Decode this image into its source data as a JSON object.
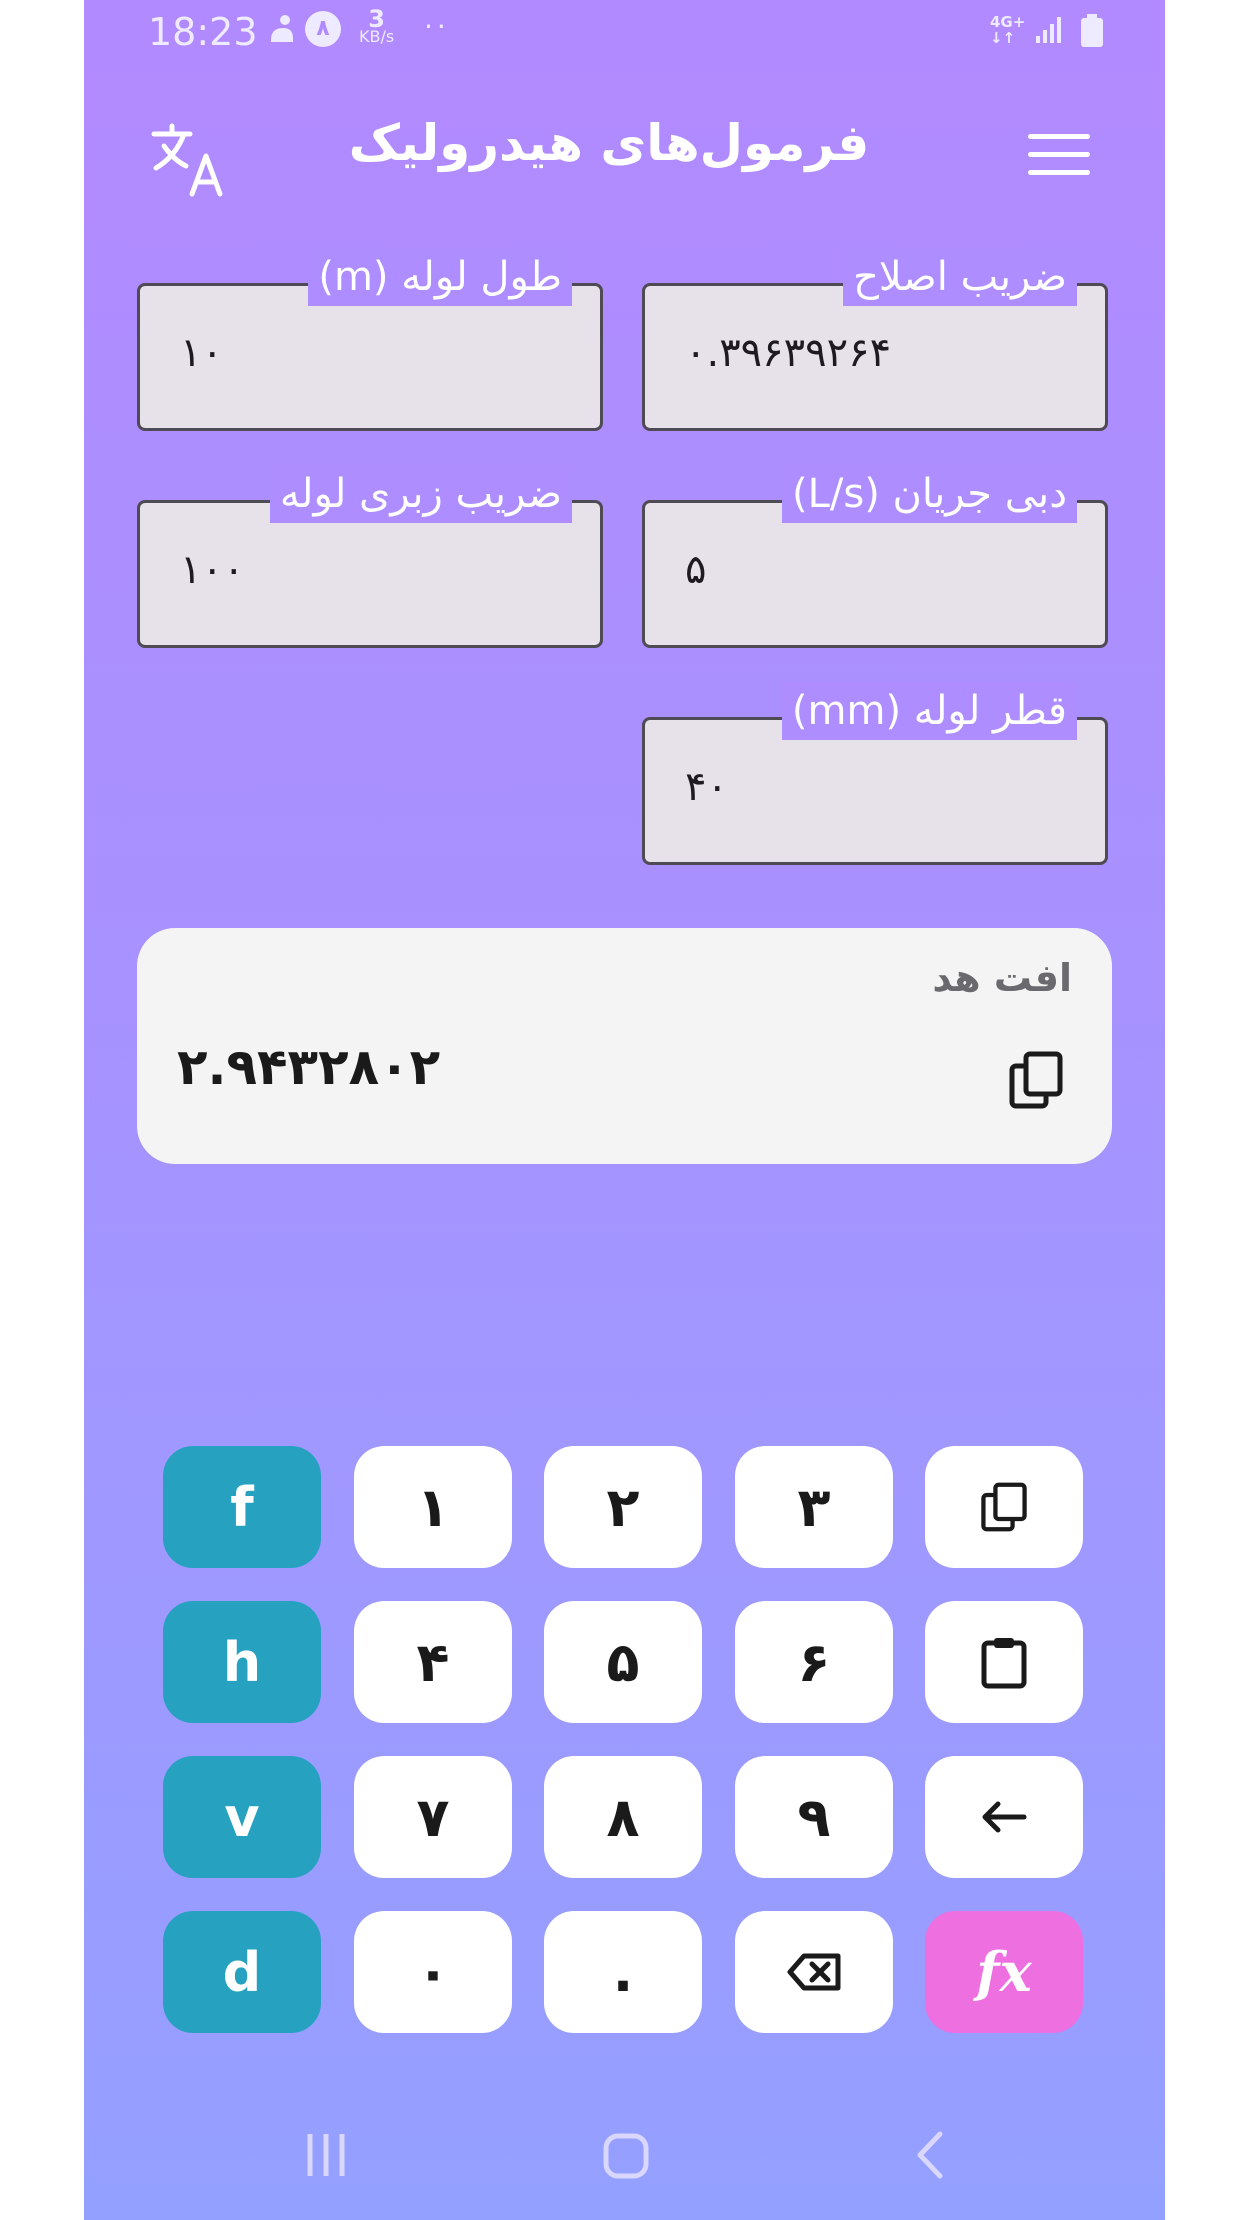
{
  "status_bar": {
    "time": "18:23",
    "badge": "۸",
    "net_speed": "3",
    "net_unit": "KB/s",
    "dots": "··",
    "network": "4G+"
  },
  "app_bar": {
    "title": "فرمول‌های هیدرولیک"
  },
  "fields": [
    {
      "label": "ضریب اصلاح",
      "value": "۰.۳۹۶۳۹۲۶۴"
    },
    {
      "label": "طول لوله (m)",
      "value": "۱۰"
    },
    {
      "label": "دبی جریان (L/s)",
      "value": "۵"
    },
    {
      "label": "ضریب زبری لوله",
      "value": "۱۰۰"
    },
    {
      "label": "قطر لوله (mm)",
      "value": "۴۰"
    }
  ],
  "result": {
    "label": "افت هد",
    "value": "۲.۹۴۳۲۸۰۲"
  },
  "keypad": {
    "row1": [
      "f",
      "۱",
      "۲",
      "۳"
    ],
    "row2": [
      "h",
      "۴",
      "۵",
      "۶"
    ],
    "row3": [
      "v",
      "۷",
      "۸",
      "۹"
    ],
    "row4": [
      "d",
      "۰",
      "."
    ],
    "fx": "fx"
  },
  "colors": {
    "accent_teal": "#27a1c0",
    "accent_pink": "#ee6fe0",
    "background_top": "#b28aff",
    "background_bottom": "#94a0ff"
  }
}
